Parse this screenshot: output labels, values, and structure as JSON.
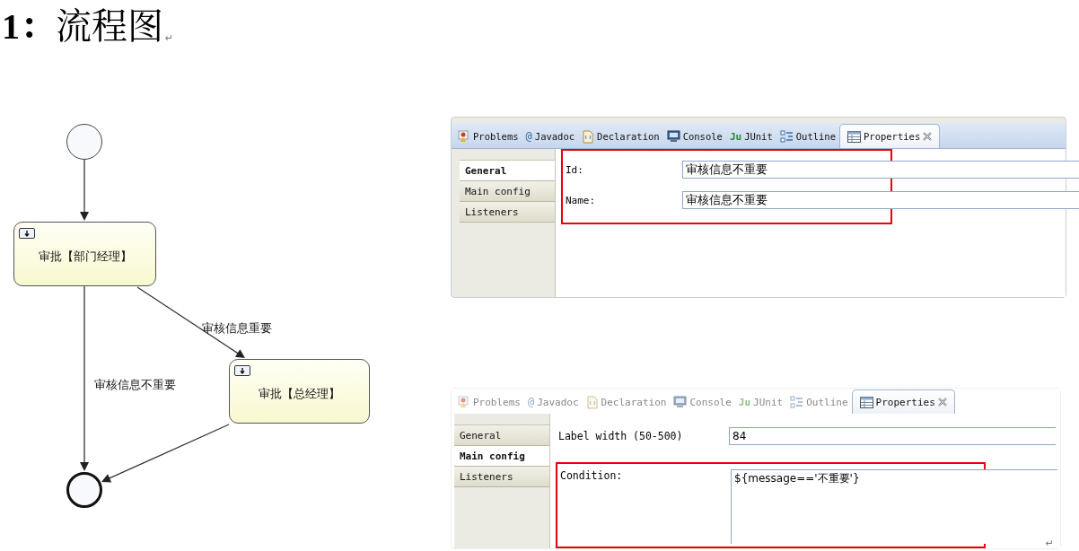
{
  "heading": {
    "text": "**1：**流程图",
    "mark": "↵"
  },
  "diagram": {
    "nodes": [
      {
        "kind": "start"
      },
      {
        "kind": "task",
        "label": "审批【部门经理】"
      },
      {
        "kind": "task",
        "label": "审批【总经理】"
      },
      {
        "kind": "end"
      }
    ],
    "edge_labels": [
      "审核信息重要",
      "审核信息不重要"
    ]
  },
  "panels": [
    {
      "active": true,
      "tabs": [
        {
          "label": "Problems",
          "selected": false
        },
        {
          "icon": "@",
          "label": "Javadoc",
          "selected": false
        },
        {
          "label": "Declaration",
          "selected": false
        },
        {
          "label": "Console",
          "selected": false
        },
        {
          "icon": "Ju",
          "label": "JUnit",
          "selected": false
        },
        {
          "label": "Outline",
          "selected": false
        },
        {
          "label": "Properties",
          "selected": true
        }
      ],
      "sidebar": [
        {
          "label": "General",
          "selected": true
        },
        {
          "label": "Main config",
          "selected": false
        },
        {
          "label": "Listeners",
          "selected": false
        }
      ],
      "groups": [
        {
          "highlighted": true,
          "rows": [
            {
              "kind": "line",
              "label": "Id:",
              "value": "审核信息不重要"
            },
            {
              "kind": "line",
              "label": "Name:",
              "value": "审核信息不重要"
            }
          ]
        }
      ]
    },
    {
      "active": false,
      "tabs": [
        {
          "label": "Problems",
          "selected": false
        },
        {
          "icon": "@",
          "label": "Javadoc",
          "selected": false
        },
        {
          "label": "Declaration",
          "selected": false
        },
        {
          "label": "Console",
          "selected": false
        },
        {
          "icon": "Ju",
          "label": "JUnit",
          "selected": false
        },
        {
          "label": "Outline",
          "selected": false
        },
        {
          "label": "Properties",
          "selected": true
        }
      ],
      "sidebar": [
        {
          "label": "General",
          "selected": false
        },
        {
          "label": "Main config",
          "selected": true
        },
        {
          "label": "Listeners",
          "selected": false
        }
      ],
      "groups": [
        {
          "highlighted": false,
          "rows": [
            {
              "kind": "line",
              "label": "Label width (50-500)",
              "value": "84"
            }
          ]
        },
        {
          "highlighted": true,
          "rows": [
            {
              "kind": "multiline",
              "label": "Condition:",
              "value": "${message=='不重要'}"
            }
          ]
        }
      ]
    }
  ],
  "paragraph_mark": "↵"
}
